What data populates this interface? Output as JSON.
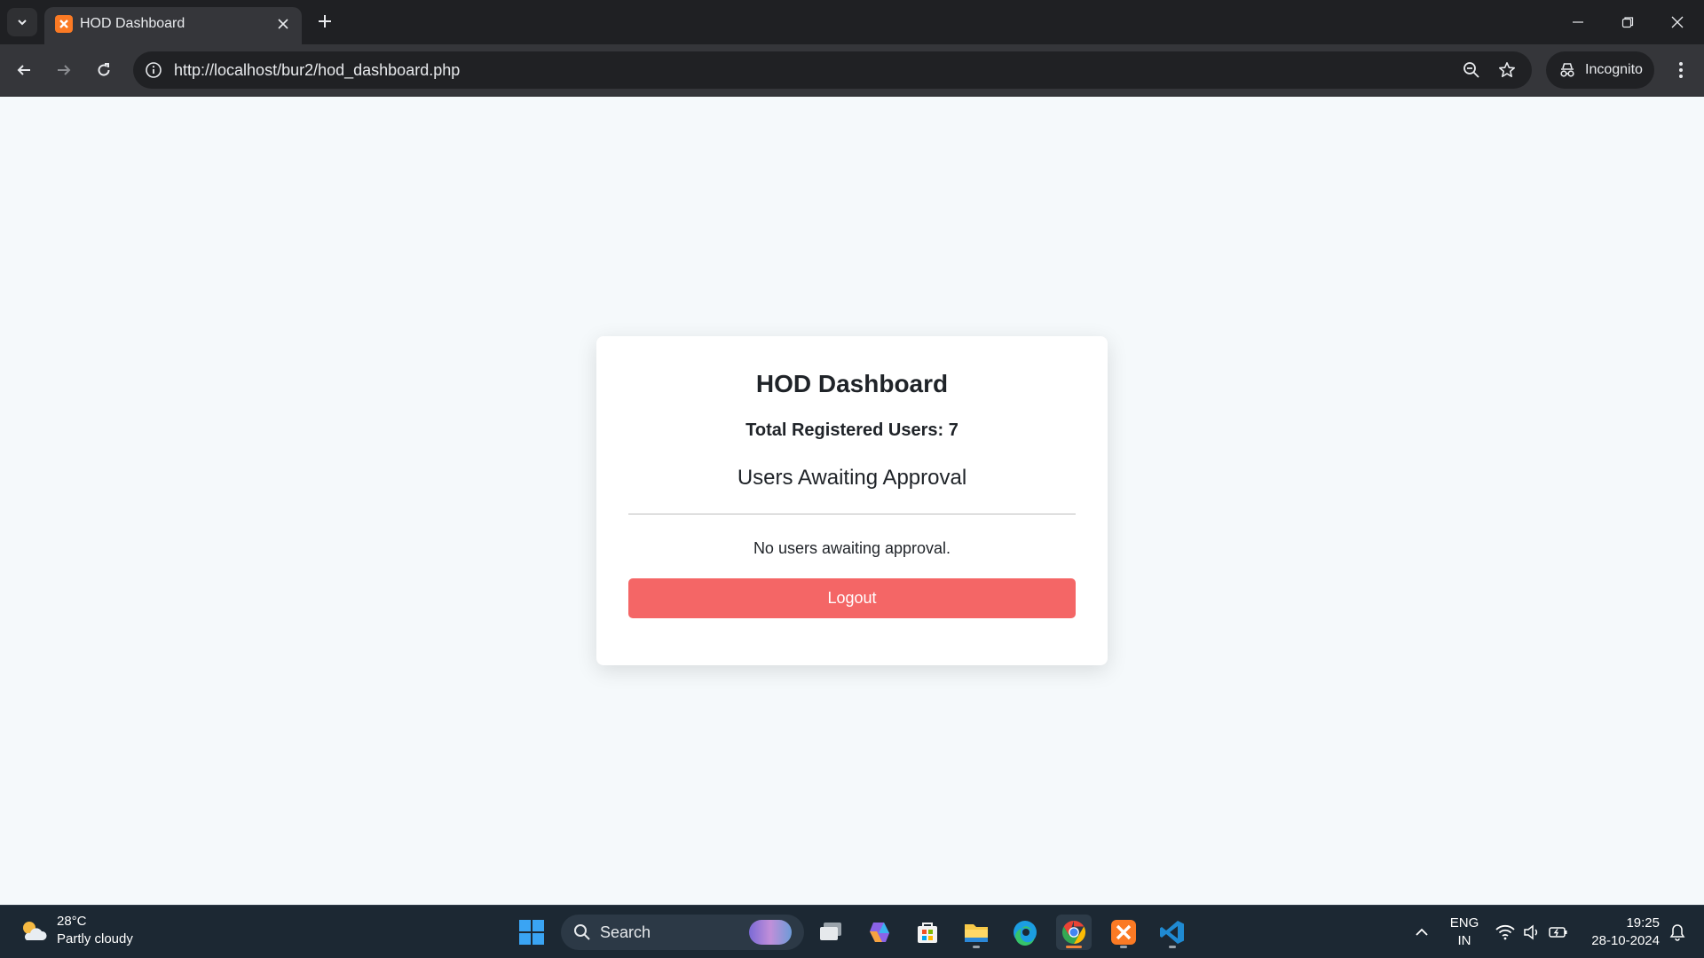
{
  "browser": {
    "tab_title": "HOD Dashboard",
    "url": "http://localhost/bur2/hod_dashboard.php",
    "incognito_label": "Incognito"
  },
  "page": {
    "title": "HOD Dashboard",
    "total_users_text": "Total Registered Users: 7",
    "awaiting_heading": "Users Awaiting Approval",
    "empty_message": "No users awaiting approval.",
    "logout_label": "Logout"
  },
  "taskbar": {
    "weather_temp": "28°C",
    "weather_desc": "Partly cloudy",
    "search_label": "Search",
    "language": "ENG",
    "region": "IN",
    "time": "19:25",
    "date": "28-10-2024"
  },
  "colors": {
    "logout_button": "#f46666",
    "page_background": "#f5f9fb",
    "card_background": "#ffffff"
  }
}
